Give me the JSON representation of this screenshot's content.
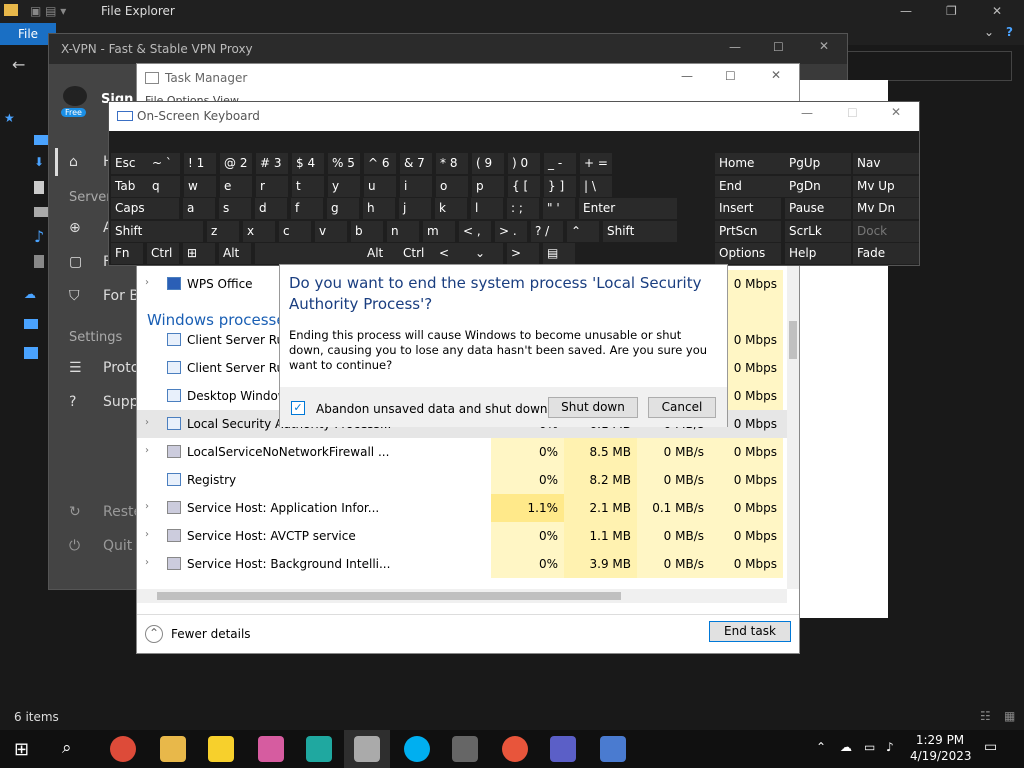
{
  "explorer": {
    "title": "File Explorer",
    "file_tab": "File",
    "status": "6 items"
  },
  "xvpn": {
    "title": "X-VPN - Fast & Stable VPN Proxy",
    "badge": "Free",
    "sign": "Sign",
    "nav": [
      "H",
      "Server",
      "A",
      "For G",
      "For B"
    ],
    "settings_header": "Settings",
    "settings": [
      "Proto",
      "Supp"
    ],
    "bottom": [
      "Reste",
      "Quit"
    ]
  },
  "taskmanager": {
    "title": "Task Manager",
    "menu": "File Options View",
    "fewer": "Fewer details",
    "end_task": "End task",
    "group": "Windows processes",
    "rows": [
      {
        "name": "WPS Office",
        "exp": "›",
        "cpu": "",
        "mem": "",
        "disk": "",
        "net": "0 Mbps"
      },
      {
        "name": "",
        "exp": "",
        "cpu": "",
        "mem": "",
        "disk": "",
        "net": ""
      },
      {
        "name": "Client Server Runtime Process",
        "exp": "",
        "cpu": "",
        "mem": "",
        "disk": "",
        "net": "0 Mbps"
      },
      {
        "name": "Client Server Runtime Process",
        "exp": "",
        "cpu": "",
        "mem": "",
        "disk": "",
        "net": "0 Mbps"
      },
      {
        "name": "Desktop Window Manager",
        "exp": "",
        "cpu": "",
        "mem": "",
        "disk": "",
        "net": "0 Mbps"
      },
      {
        "name": "Local Security Authority Process...",
        "exp": "›",
        "cpu": "0%",
        "mem": "6.1 MB",
        "disk": "0 MB/s",
        "net": "0 Mbps"
      },
      {
        "name": "LocalServiceNoNetworkFirewall ...",
        "exp": "›",
        "cpu": "0%",
        "mem": "8.5 MB",
        "disk": "0 MB/s",
        "net": "0 Mbps"
      },
      {
        "name": "Registry",
        "exp": "",
        "cpu": "0%",
        "mem": "8.2 MB",
        "disk": "0 MB/s",
        "net": "0 Mbps"
      },
      {
        "name": "Service Host: Application Infor...",
        "exp": "›",
        "cpu": "1.1%",
        "mem": "2.1 MB",
        "disk": "0.1 MB/s",
        "net": "0 Mbps"
      },
      {
        "name": "Service Host: AVCTP service",
        "exp": "›",
        "cpu": "0%",
        "mem": "1.1 MB",
        "disk": "0 MB/s",
        "net": "0 Mbps"
      },
      {
        "name": "Service Host: Background Intelli...",
        "exp": "›",
        "cpu": "0%",
        "mem": "3.9 MB",
        "disk": "0 MB/s",
        "net": "0 Mbps"
      }
    ]
  },
  "osk": {
    "title": "On-Screen Keyboard"
  },
  "dialog": {
    "heading": "Do you want to end the system process 'Local Security Authority Process'?",
    "body": "Ending this process will cause Windows to become unusable or shut down, causing you to lose any data hasn't been saved. Are you sure you want to continue?",
    "checkbox": "Abandon unsaved data and shut down.",
    "shutdown": "Shut down",
    "cancel": "Cancel",
    "checked": true
  },
  "taskbar": {
    "time": "1:29 PM",
    "date": "4/19/2023"
  }
}
